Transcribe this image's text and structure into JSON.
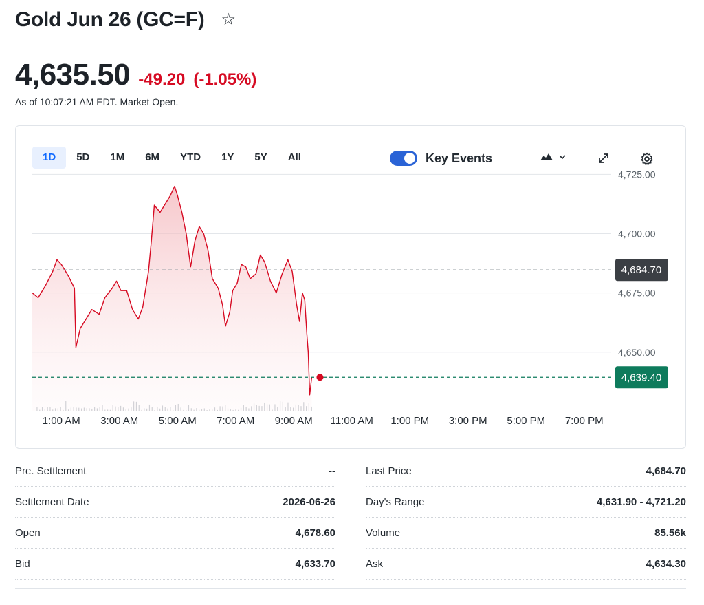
{
  "header": {
    "title": "Gold Jun 26 (GC=F)",
    "star_icon": "star-outline"
  },
  "quote": {
    "price": "4,635.50",
    "change": "-49.20",
    "change_pct": "(-1.05%)",
    "as_of": "As of 10:07:21 AM EDT. Market Open.",
    "negative_color": "#d60a22"
  },
  "chart_controls": {
    "ranges": [
      "1D",
      "5D",
      "1M",
      "6M",
      "YTD",
      "1Y",
      "5Y",
      "All"
    ],
    "active_range": "1D",
    "key_events_label": "Key Events",
    "key_events_on": true
  },
  "chart_data": {
    "type": "area",
    "title": "",
    "x_labels": [
      "1:00 AM",
      "3:00 AM",
      "5:00 AM",
      "7:00 AM",
      "9:00 AM",
      "11:00 AM",
      "1:00 PM",
      "3:00 PM",
      "5:00 PM",
      "7:00 PM"
    ],
    "y_ticks": [
      "4,725.00",
      "4,700.00",
      "4,675.00",
      "4,650.00"
    ],
    "ylim": [
      4627,
      4728
    ],
    "x_range_hours": [
      0,
      20
    ],
    "series": [
      {
        "color": "#d60a22",
        "points": [
          [
            0.0,
            4675
          ],
          [
            0.2,
            4673
          ],
          [
            0.45,
            4678
          ],
          [
            0.7,
            4684
          ],
          [
            0.85,
            4689
          ],
          [
            1.0,
            4687
          ],
          [
            1.25,
            4682
          ],
          [
            1.45,
            4677
          ],
          [
            1.5,
            4652
          ],
          [
            1.65,
            4660
          ],
          [
            1.85,
            4664
          ],
          [
            2.05,
            4668
          ],
          [
            2.3,
            4666
          ],
          [
            2.5,
            4673
          ],
          [
            2.75,
            4677
          ],
          [
            2.9,
            4680
          ],
          [
            3.05,
            4676
          ],
          [
            3.25,
            4676
          ],
          [
            3.45,
            4668
          ],
          [
            3.65,
            4664
          ],
          [
            3.8,
            4669
          ],
          [
            4.0,
            4684
          ],
          [
            4.1,
            4697
          ],
          [
            4.2,
            4712
          ],
          [
            4.4,
            4709
          ],
          [
            4.6,
            4713
          ],
          [
            4.75,
            4716
          ],
          [
            4.9,
            4720
          ],
          [
            5.0,
            4716
          ],
          [
            5.15,
            4709
          ],
          [
            5.3,
            4700
          ],
          [
            5.45,
            4686
          ],
          [
            5.6,
            4697
          ],
          [
            5.75,
            4703
          ],
          [
            5.9,
            4700
          ],
          [
            6.05,
            4693
          ],
          [
            6.2,
            4681
          ],
          [
            6.4,
            4677
          ],
          [
            6.55,
            4670
          ],
          [
            6.65,
            4661
          ],
          [
            6.8,
            4667
          ],
          [
            6.9,
            4676
          ],
          [
            7.05,
            4679
          ],
          [
            7.2,
            4687
          ],
          [
            7.35,
            4686
          ],
          [
            7.5,
            4681
          ],
          [
            7.7,
            4683
          ],
          [
            7.85,
            4691
          ],
          [
            8.0,
            4688
          ],
          [
            8.2,
            4680
          ],
          [
            8.4,
            4675
          ],
          [
            8.6,
            4683
          ],
          [
            8.8,
            4689
          ],
          [
            8.95,
            4684
          ],
          [
            9.1,
            4670
          ],
          [
            9.2,
            4663
          ],
          [
            9.3,
            4675
          ],
          [
            9.38,
            4672
          ],
          [
            9.45,
            4658
          ],
          [
            9.5,
            4650
          ],
          [
            9.55,
            4632
          ],
          [
            9.62,
            4639.4
          ]
        ]
      }
    ],
    "reference_lines": [
      {
        "value": 4684.7,
        "label": "4,684.70",
        "color": "#3b3f44",
        "meaning": "previous close"
      },
      {
        "value": 4639.4,
        "label": "4,639.40",
        "color": "#0e7b5c",
        "meaning": "current"
      }
    ],
    "current_point": {
      "x": 9.62,
      "y": 4639.4
    },
    "grid": true,
    "volume_bars": true
  },
  "stats": {
    "left": [
      {
        "label": "Pre. Settlement",
        "value": "--"
      },
      {
        "label": "Settlement Date",
        "value": "2026-06-26"
      },
      {
        "label": "Open",
        "value": "4,678.60"
      },
      {
        "label": "Bid",
        "value": "4,633.70"
      }
    ],
    "right": [
      {
        "label": "Last Price",
        "value": "4,684.70"
      },
      {
        "label": "Day's Range",
        "value": "4,631.90 - 4,721.20"
      },
      {
        "label": "Volume",
        "value": "85.56k"
      },
      {
        "label": "Ask",
        "value": "4,634.30"
      }
    ]
  }
}
